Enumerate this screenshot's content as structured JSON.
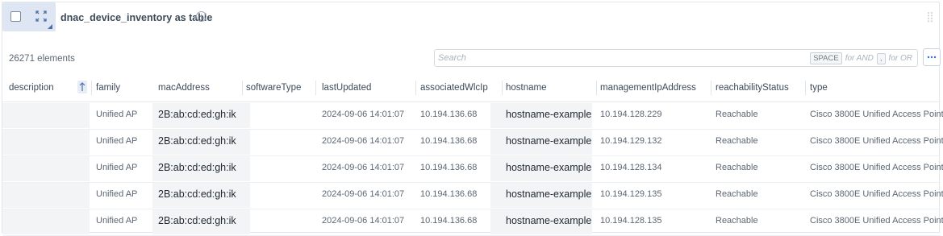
{
  "header": {
    "title": "dnac_device_inventory as table",
    "icons": [
      "checkbox-icon",
      "expand-icon",
      "info-icon",
      "drag-handle-icon"
    ]
  },
  "toolbar": {
    "element_count": "26271 elements",
    "search_placeholder": "Search",
    "search_value": "",
    "hint_space": "SPACE",
    "hint_and": "for AND",
    "hint_comma": ",",
    "hint_or": "for OR",
    "more_label": "···"
  },
  "colors": {
    "header_tool_bg": "#dfe6f3",
    "accent": "#2f6fd8",
    "cell_shade": "#f3f4f6"
  },
  "table": {
    "columns": [
      "description",
      "family",
      "macAddress",
      "softwareType",
      "lastUpdated",
      "associatedWlcIp",
      "hostname",
      "managementIpAddress",
      "reachabilityStatus",
      "type"
    ],
    "rows": [
      [
        "",
        "Unified AP",
        "2B:ab:cd:ed:gh:ik",
        "",
        "2024-09-06 14:01:07",
        "10.194.136.68",
        "hostname-example",
        "10.194.128.229",
        "Reachable",
        "Cisco 3800E Unified Access Point"
      ],
      [
        "",
        "Unified AP",
        "2B:ab:cd:ed:gh:ik",
        "",
        "2024-09-06 14:01:07",
        "10.194.136.68",
        "hostname-example",
        "10.194.129.132",
        "Reachable",
        "Cisco 3800E Unified Access Point"
      ],
      [
        "",
        "Unified AP",
        "2B:ab:cd:ed:gh:ik",
        "",
        "2024-09-06 14:01:07",
        "10.194.136.68",
        "hostname-example",
        "10.194.128.134",
        "Reachable",
        "Cisco 3800E Unified Access Point"
      ],
      [
        "",
        "Unified AP",
        "2B:ab:cd:ed:gh:ik",
        "",
        "2024-09-06 14:01:07",
        "10.194.136.68",
        "hostname-example",
        "10.194.129.135",
        "Reachable",
        "Cisco 3800E Unified Access Point"
      ],
      [
        "",
        "Unified AP",
        "2B:ab:cd:ed:gh:ik",
        "",
        "2024-09-06 14:01:07",
        "10.194.136.68",
        "hostname-example",
        "10.194.128.135",
        "Reachable",
        "Cisco 3800E Unified Access Point"
      ]
    ]
  }
}
